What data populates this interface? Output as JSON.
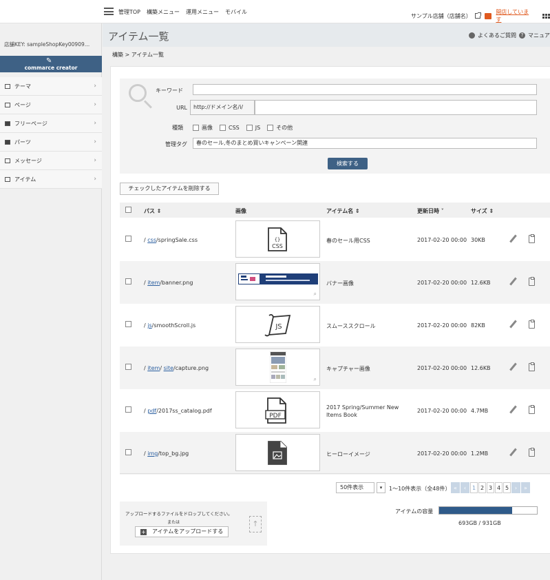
{
  "topbar": {
    "nav": [
      "管理TOP",
      "構築メニュー",
      "運用メニュー",
      "モバイル"
    ],
    "shop_name": "サンプル店舗（店舗名）",
    "status": "開店しています"
  },
  "sidebar": {
    "shop_key": "店舗KEY: sampleShopKey00909…",
    "brand": "commarce creator",
    "items": [
      {
        "label": "テーマ",
        "icon": "theme-icon"
      },
      {
        "label": "ページ",
        "icon": "page-icon"
      },
      {
        "label": "フリーページ",
        "icon": "free-page-icon"
      },
      {
        "label": "パーツ",
        "icon": "parts-icon"
      },
      {
        "label": "メッセージ",
        "icon": "message-icon"
      },
      {
        "label": "アイテム",
        "icon": "image-icon"
      }
    ]
  },
  "header": {
    "title": "アイテム一覧",
    "faq": "よくあるご質問",
    "manual": "マニュア"
  },
  "breadcrumb": "構築 > アイテム一覧",
  "search": {
    "keyword_label": "キーワード",
    "keyword_value": "",
    "url_label": "URL",
    "url_prefix": "http://ドメイン名/i/",
    "url_value": "",
    "type_label": "種類",
    "types": [
      "画像",
      "CSS",
      "JS",
      "その他"
    ],
    "tag_label": "管理タグ",
    "tag_value": "春のセール,冬のまとめ買いキャンペーン関連",
    "button": "検索する"
  },
  "delete_button": "チェックしたアイテムを削除する",
  "table": {
    "headers": {
      "path": "パス",
      "image": "画像",
      "name": "アイテム名",
      "updated": "更新日時",
      "size": "サイズ"
    },
    "rows": [
      {
        "path_link": "css",
        "path_rest": "/springSale.css",
        "name": "春のセール用CSS",
        "updated": "2017-02-20 00:00",
        "size": "30KB",
        "thumb": "css"
      },
      {
        "path_link": "item",
        "path_rest": "/banner.png",
        "name": "バナー画像",
        "updated": "2017-02-20 00:00",
        "size": "12.6KB",
        "thumb": "banner"
      },
      {
        "path_link": "js",
        "path_rest": "/smoothScroll.js",
        "name": "スムーススクロール",
        "updated": "2017-02-20 00:00",
        "size": "82KB",
        "thumb": "js"
      },
      {
        "path_link": "item",
        "path_link2": "site",
        "path_rest": "/capture.png",
        "name": "キャプチャー画像",
        "updated": "2017-02-20 00:00",
        "size": "12.6KB",
        "thumb": "capture"
      },
      {
        "path_link": "pdf",
        "path_rest": "/2017ss_catalog.pdf",
        "name": "2017 Spring/Summer New Items Book",
        "updated": "2017-02-20 00:00",
        "size": "4.7MB",
        "thumb": "pdf"
      },
      {
        "path_link": "img",
        "path_rest": "/top_bg.jpg",
        "name": "ヒーローイメージ",
        "updated": "2017-02-20 00:00",
        "size": "1.2MB",
        "thumb": "jpg"
      }
    ]
  },
  "pagination": {
    "per_page": "50件表示",
    "count": "1〜10件表示（全48件）",
    "pages": [
      "1",
      "2",
      "3",
      "4",
      "5"
    ],
    "current": "1"
  },
  "upload": {
    "drop_text": "アップロードするファイルをドロップしてください。",
    "or": "または",
    "button": "アイテムをアップロードする"
  },
  "capacity": {
    "label": "アイテムの容量",
    "text": "693GB / 931GB",
    "used_fraction": 0.744
  },
  "colors": {
    "accent": "#3e6185",
    "open": "#e05a1f"
  }
}
